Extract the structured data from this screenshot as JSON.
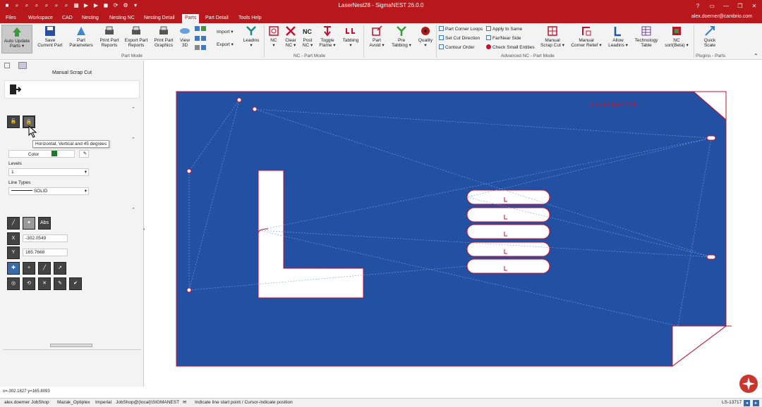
{
  "window": {
    "title": "LaserNest28 - SigmaNEST 26.0.0",
    "help_label": "?"
  },
  "menu": {
    "tabs": [
      "Files",
      "Workspace",
      "CAD",
      "Nesting",
      "Nesting NC",
      "Nesting Detail",
      "Parts",
      "Part Detail",
      "Tools Help"
    ],
    "active_tab": "Parts",
    "user": "alex.doerner@cambrio.com"
  },
  "ribbon": {
    "part_mode": {
      "buttons": [
        {
          "label1": "Auto Update",
          "label2": "Parts ▾",
          "icon": "auto-update-icon"
        },
        {
          "label1": "Save",
          "label2": "Current Part",
          "icon": "save-icon"
        },
        {
          "label1": "Part",
          "label2": "Parameters",
          "icon": "part-parameters-icon"
        },
        {
          "label1": "Print Part",
          "label2": "Reports",
          "icon": "printer-icon"
        },
        {
          "label1": "Export Part",
          "label2": "Reports",
          "icon": "printer-icon"
        },
        {
          "label1": "Print Part",
          "label2": "Graphics",
          "icon": "printer-icon"
        },
        {
          "label1": "View",
          "label2": "3D",
          "icon": "view-3d-icon"
        }
      ],
      "import_label": "Import",
      "export_label": "Export",
      "leadins_label": "Leadins",
      "group_label": "Part Mode"
    },
    "nc_part_mode": {
      "buttons": [
        {
          "label1": "NC",
          "label2": "▾",
          "icon": "nc-icon"
        },
        {
          "label1": "Clear",
          "label2": "NC ▾",
          "icon": "clear-nc-icon"
        },
        {
          "label1": "Post",
          "label2": "NC ▾",
          "icon": "post-nc-icon"
        },
        {
          "label1": "Toggle",
          "label2": "Flame ▾",
          "icon": "toggle-flame-icon"
        },
        {
          "label1": "Tabbing",
          "label2": "▾",
          "icon": "tabbing-icon"
        },
        {
          "label1": "Part",
          "label2": "Avoid ▾",
          "icon": "part-avoid-icon"
        },
        {
          "label1": "Pre",
          "label2": "Tabbing ▾",
          "icon": "pre-tabbing-icon"
        },
        {
          "label1": "Quality",
          "label2": "▾",
          "icon": "quality-icon"
        }
      ],
      "group_label": "NC - Part Mode"
    },
    "advanced": {
      "small_buttons": [
        "Part Corner Loops",
        "Set Cut Direction",
        "Contour Order",
        "Apply to Same",
        "Far/Near Side",
        "Check Small Entities"
      ],
      "buttons": [
        {
          "label1": "Manual",
          "label2": "Scrap Cut ▾",
          "icon": "manual-scrap-cut-icon"
        },
        {
          "label1": "Manual",
          "label2": "Corner Relief ▾",
          "icon": "corner-relief-icon"
        },
        {
          "label1": "Allow",
          "label2": "Leadins ▾",
          "icon": "allow-leadins-icon"
        },
        {
          "label1": "Technology",
          "label2": "Table",
          "icon": "technology-table-icon"
        },
        {
          "label1": "NC",
          "label2": "sort(Beta) ▾",
          "icon": "nc-sort-icon"
        }
      ],
      "group_label": "Advanced NC - Part Mode"
    },
    "plugins": {
      "buttons": [
        {
          "label1": "Quick",
          "label2": "Scale",
          "icon": "quick-scale-icon"
        }
      ],
      "group_label": "Plugins - Parts"
    }
  },
  "panel": {
    "title": "Manual Scrap Cut",
    "tooltip": "Horizontal, Vertical and 45 degrees",
    "color_label": "Color",
    "color_value": "#1a7a2a",
    "levels_label": "Levels",
    "levels_value": "1",
    "linetypes_label": "Line Types",
    "linetype_value": "SOLID",
    "abs_label": "Abs",
    "x_label": "X",
    "x_value": "-302.0549",
    "y_label": "Y",
    "y_value": "165.7668",
    "coords": "x=-302.1827 y=165.8093"
  },
  "canvas": {
    "sheet_color": "#2250a3",
    "sheet_text": "LaserNest28",
    "part_color": "#ffffff",
    "outline_color": "#c8102e"
  },
  "status": {
    "user": "alex.doerner JobShop",
    "machine": "Mazak_Optiplex",
    "units": "Imperial",
    "db": "JobShop@(local)\\SIGMANEST",
    "hint": "Indicate line start point / Cursor-indicate position",
    "code": "LS-13717"
  }
}
